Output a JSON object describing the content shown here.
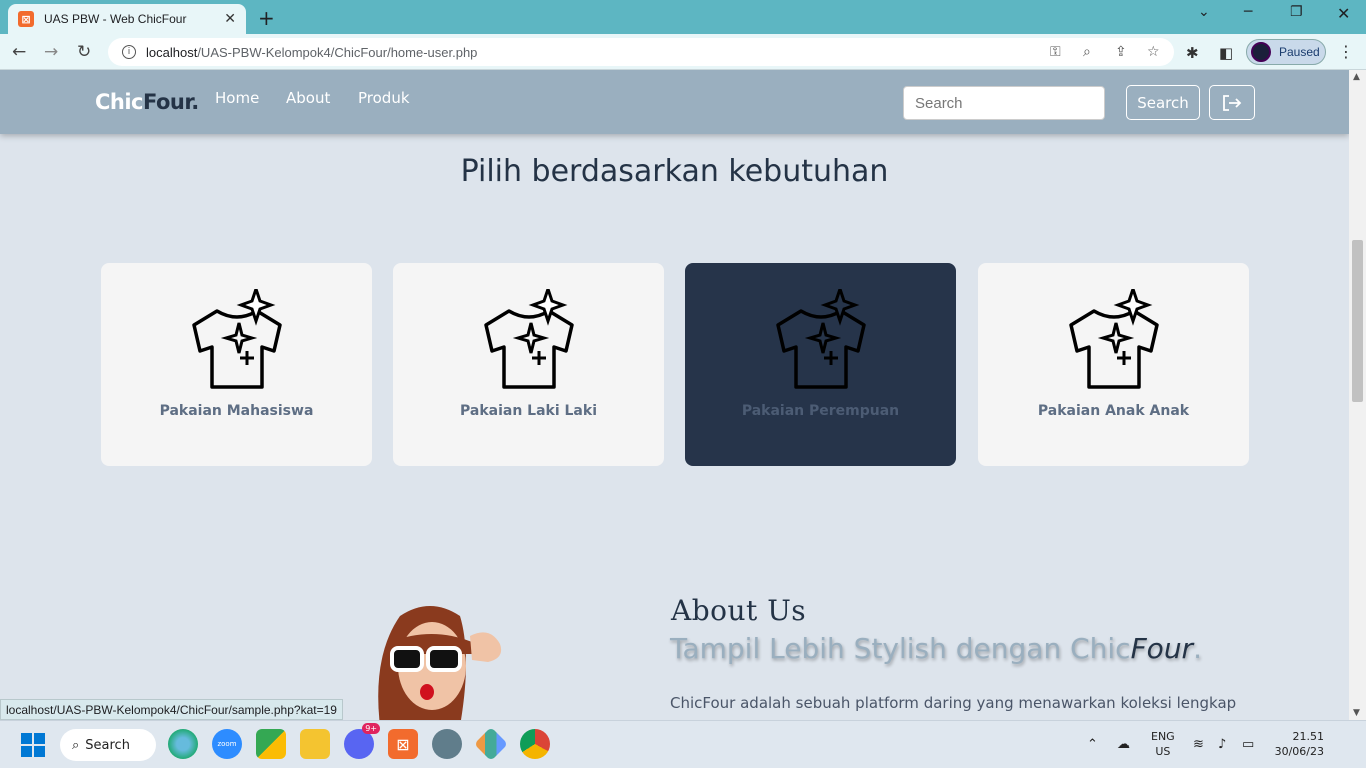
{
  "browser": {
    "tab_title": "UAS PBW - Web ChicFour",
    "url_host": "localhost",
    "url_path": "/UAS-PBW-Kelompok4/ChicFour/home-user.php",
    "profile_status": "Paused",
    "status_url": "localhost/UAS-PBW-Kelompok4/ChicFour/sample.php?kat=19"
  },
  "site": {
    "logo_a": "Chic",
    "logo_b": "Four",
    "logo_dot": ".",
    "nav": [
      "Home",
      "About",
      "Produk"
    ],
    "search_placeholder": "Search",
    "search_button": "Search"
  },
  "categories": {
    "heading": "Pilih berdasarkan kebutuhan",
    "items": [
      {
        "label": "Pakaian Mahasiswa",
        "active": false
      },
      {
        "label": "Pakaian Laki Laki",
        "active": false
      },
      {
        "label": "Pakaian Perempuan",
        "active": true
      },
      {
        "label": "Pakaian Anak Anak",
        "active": false
      }
    ]
  },
  "about": {
    "title": "About Us",
    "subtitle_a": "Tampil Lebih Stylish dengan Chic",
    "subtitle_b": "Four",
    "subtitle_c": ".",
    "paragraph": "ChicFour adalah sebuah platform daring yang menawarkan koleksi lengkap"
  },
  "taskbar": {
    "search_label": "Search",
    "lang_top": "ENG",
    "lang_bottom": "US",
    "time": "21.51",
    "date": "30/06/23",
    "discord_badge": "9+"
  },
  "colors": {
    "nav_bg": "#9aafbf",
    "page_bg": "#dde4ec",
    "dark_navy": "#26344a",
    "chrome_teal": "#5db6c2"
  }
}
